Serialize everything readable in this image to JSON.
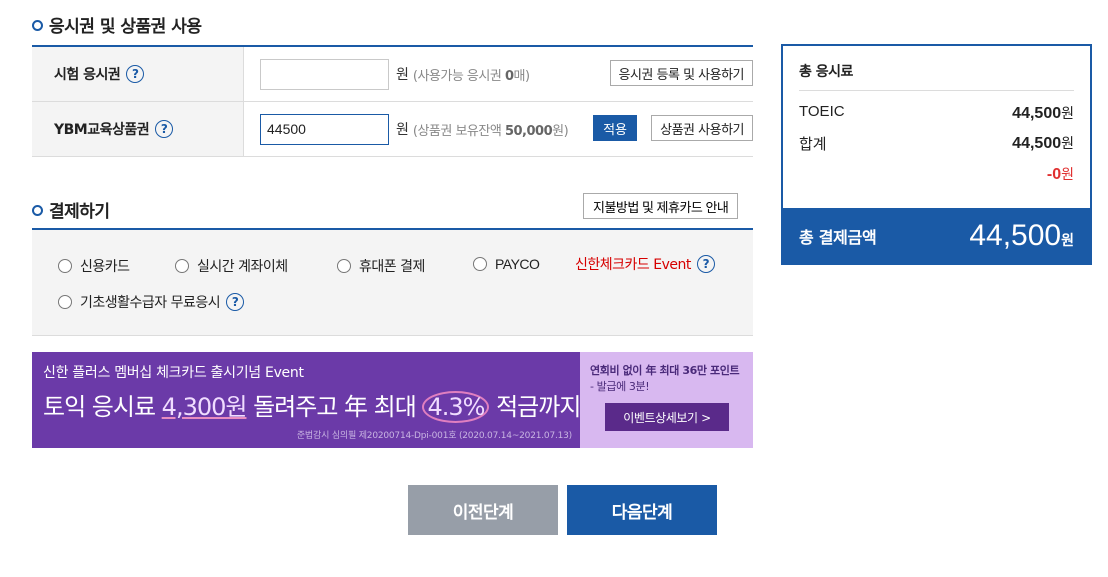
{
  "voucher_section": {
    "title": "응시권 및 상품권 사용",
    "exam_voucher": {
      "label": "시험 응시권",
      "value": "",
      "unit": "원",
      "note_prefix": "(사용가능 응시권 ",
      "note_count": "0",
      "note_suffix": "매)",
      "register_button": "응시권 등록 및 사용하기"
    },
    "gift_voucher": {
      "label": "YBM교육상품권",
      "value": "44500",
      "unit": "원",
      "note_prefix": "(상품권 보유잔액 ",
      "note_amount": "50,000",
      "note_suffix": "원)",
      "apply_button": "적용",
      "use_button": "상품권 사용하기"
    },
    "help_icon": "?"
  },
  "payment_section": {
    "title": "결제하기",
    "guide_button": "지불방법 및 제휴카드 안내",
    "methods": [
      {
        "label": "신용카드"
      },
      {
        "label": "실시간 계좌이체"
      },
      {
        "label": "휴대폰 결제"
      },
      {
        "label": "PAYCO"
      },
      {
        "label": "신한체크카드 Event"
      },
      {
        "label": "기초생활수급자 무료응시"
      }
    ]
  },
  "banner": {
    "top_line": "신한 플러스 멤버십 체크카드 출시기념 Event",
    "main_pre": "토익 응시료 ",
    "main_amount": "4,300원",
    "main_mid": " 돌려주고 年 최대 ",
    "main_rate": "4.3%",
    "main_post": " 적금까지!",
    "fine_print": "준법감시 심의필 제20200714-Dpi-001호 (2020.07.14~2021.07.13)",
    "right_line1": "연회비 없이 年 최대 36만 포인트",
    "right_line2": "- 발급에 3분!",
    "detail_button": "이벤트상세보기 >"
  },
  "navigation": {
    "prev_button": "이전단계",
    "next_button": "다음단계"
  },
  "summary": {
    "title": "총 응시료",
    "items": [
      {
        "label": "TOEIC",
        "amount": "44,500",
        "unit": "원"
      },
      {
        "label": "합계",
        "amount": "44,500",
        "unit": "원"
      }
    ],
    "discount": "-0",
    "discount_unit": "원",
    "total_label": "총 결제금액",
    "total_amount": "44,500",
    "total_unit": "원"
  },
  "colors": {
    "accent": "#1a5aa6",
    "discount": "#e03030",
    "event": "#d60000",
    "banner_purple": "#6b3aa8"
  }
}
